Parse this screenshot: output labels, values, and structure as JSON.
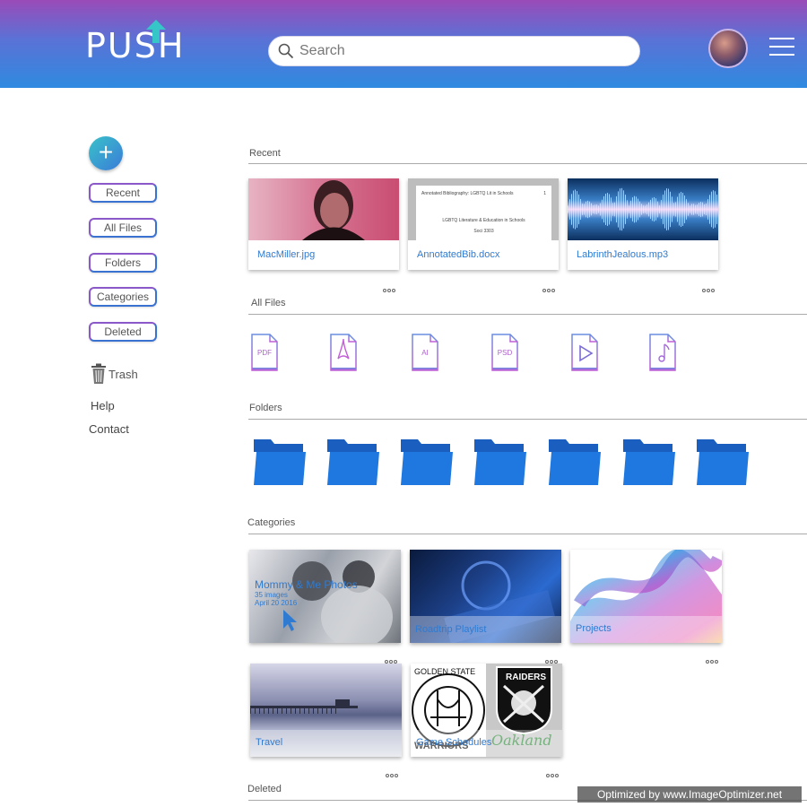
{
  "header": {
    "logo": "PUSH",
    "search_placeholder": "Search",
    "colors": {
      "top": "#9a4bb8",
      "bottom": "#2f8ae0"
    }
  },
  "sidebar": {
    "add_label": "+",
    "buttons": [
      "Recent",
      "All Files",
      "Folders",
      "Categories",
      "Deleted"
    ],
    "trash": "Trash",
    "help": "Help",
    "contact": "Contact"
  },
  "sections": {
    "recent": "Recent",
    "all_files": "All Files",
    "folders": "Folders",
    "categories": "Categories",
    "deleted": "Deleted"
  },
  "recent_files": [
    {
      "name": "MacMiller.jpg",
      "thumb": "photo-icon"
    },
    {
      "name": "AnnotatedBib.docx",
      "thumb": "document-icon",
      "doc_header": "Annotated Bibliography: LGBTQ Lit in Schools",
      "doc_page": "1",
      "doc_title": "LGBTQ Literature & Education in Schools",
      "doc_sub": "Soci 3303"
    },
    {
      "name": "LabrinthJealous.mp3",
      "thumb": "audio-waveform-icon"
    }
  ],
  "file_types": [
    {
      "icon": "pdf-file-icon",
      "label": "PDF"
    },
    {
      "icon": "acrobat-file-icon",
      "label": ""
    },
    {
      "icon": "ai-file-icon",
      "label": "AI"
    },
    {
      "icon": "psd-file-icon",
      "label": "PSD"
    },
    {
      "icon": "video-file-icon",
      "label": ""
    },
    {
      "icon": "audio-file-icon",
      "label": ""
    }
  ],
  "folder_count": 7,
  "categories": [
    {
      "title": "Mommy & Me Photos",
      "count": "35 images",
      "date": "April 20 2016"
    },
    {
      "title": "Roadtrip Playlist"
    },
    {
      "title": "Projects"
    },
    {
      "title": "Travel"
    },
    {
      "title": "Game Schedules",
      "team_left": "GOLDEN STATE",
      "team_left_2": "WARRIORS",
      "team_right": "RAIDERS",
      "team_right_2": "Oakland"
    }
  ],
  "more_icon": "more-dots-icon",
  "watermark": "Optimized by www.ImageOptimizer.net"
}
